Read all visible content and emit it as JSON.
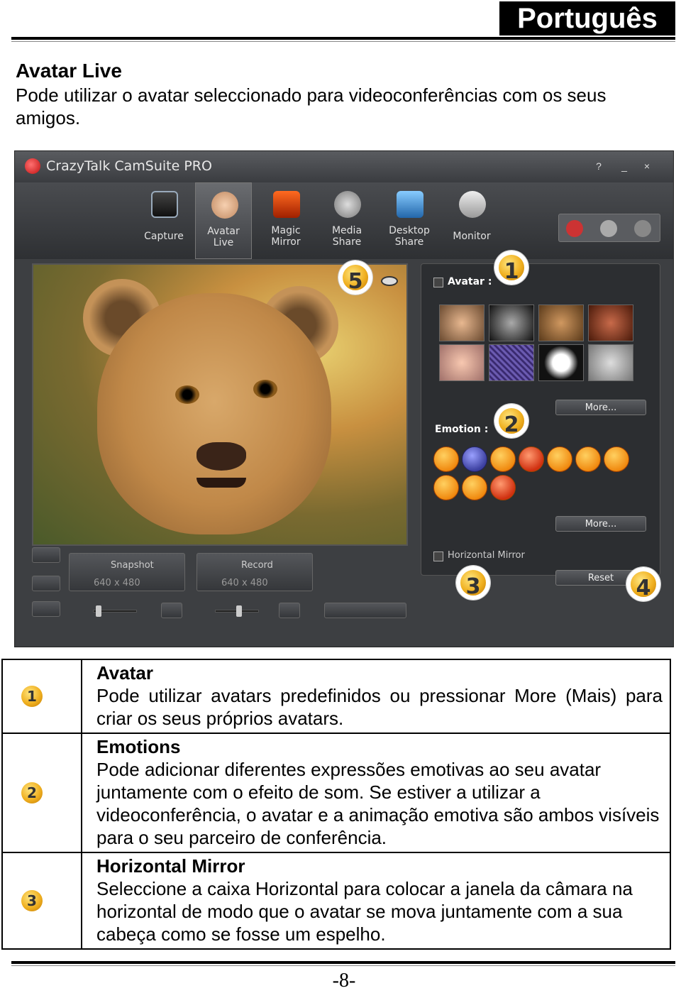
{
  "header": {
    "language_tab": "Português"
  },
  "section": {
    "title": "Avatar Live",
    "description": "Pode utilizar o avatar seleccionado para videoconferências com os seus amigos."
  },
  "app": {
    "title": "CrazyTalk CamSuite PRO",
    "window_buttons": [
      "?",
      "_",
      "×"
    ],
    "toolbar": [
      {
        "label": "Capture",
        "icon": "camera-icon"
      },
      {
        "label": "Avatar\nLive",
        "icon": "avatar-face-icon"
      },
      {
        "label": "Magic\nMirror",
        "icon": "mask-icon"
      },
      {
        "label": "Media\nShare",
        "icon": "film-reel-icon"
      },
      {
        "label": "Desktop\nShare",
        "icon": "desktop-icon"
      },
      {
        "label": "Monitor",
        "icon": "security-camera-icon"
      }
    ],
    "avatar_panel": {
      "label": "Avatar :",
      "more_label": "More..."
    },
    "emotion_panel": {
      "label": "Emotion :",
      "more_label": "More..."
    },
    "horizontal_mirror_label": "Horizontal Mirror",
    "reset_label": "Reset",
    "snapshot": {
      "label": "Snapshot",
      "size": "640 x 480"
    },
    "record": {
      "label": "Record",
      "size": "640 x 480"
    },
    "badges": [
      "1",
      "2",
      "3",
      "4",
      "5"
    ]
  },
  "table": [
    {
      "number": "1",
      "title": "Avatar",
      "body": "Pode utilizar avatars predefinidos ou pressionar More (Mais) para criar os seus próprios avatars."
    },
    {
      "number": "2",
      "title": "Emotions",
      "body": "Pode adicionar diferentes expressões emotivas ao seu avatar juntamente com o efeito de som. Se estiver a utilizar a videoconferência, o avatar e a animação emotiva são ambos visíveis para o seu parceiro de conferência."
    },
    {
      "number": "3",
      "title": "Horizontal Mirror",
      "body": "Seleccione a caixa Horizontal para colocar a janela da câmara na horizontal de modo que o avatar se mova juntamente com a sua cabeça como se fosse um espelho."
    }
  ],
  "footer": {
    "page_number": "-8-"
  }
}
